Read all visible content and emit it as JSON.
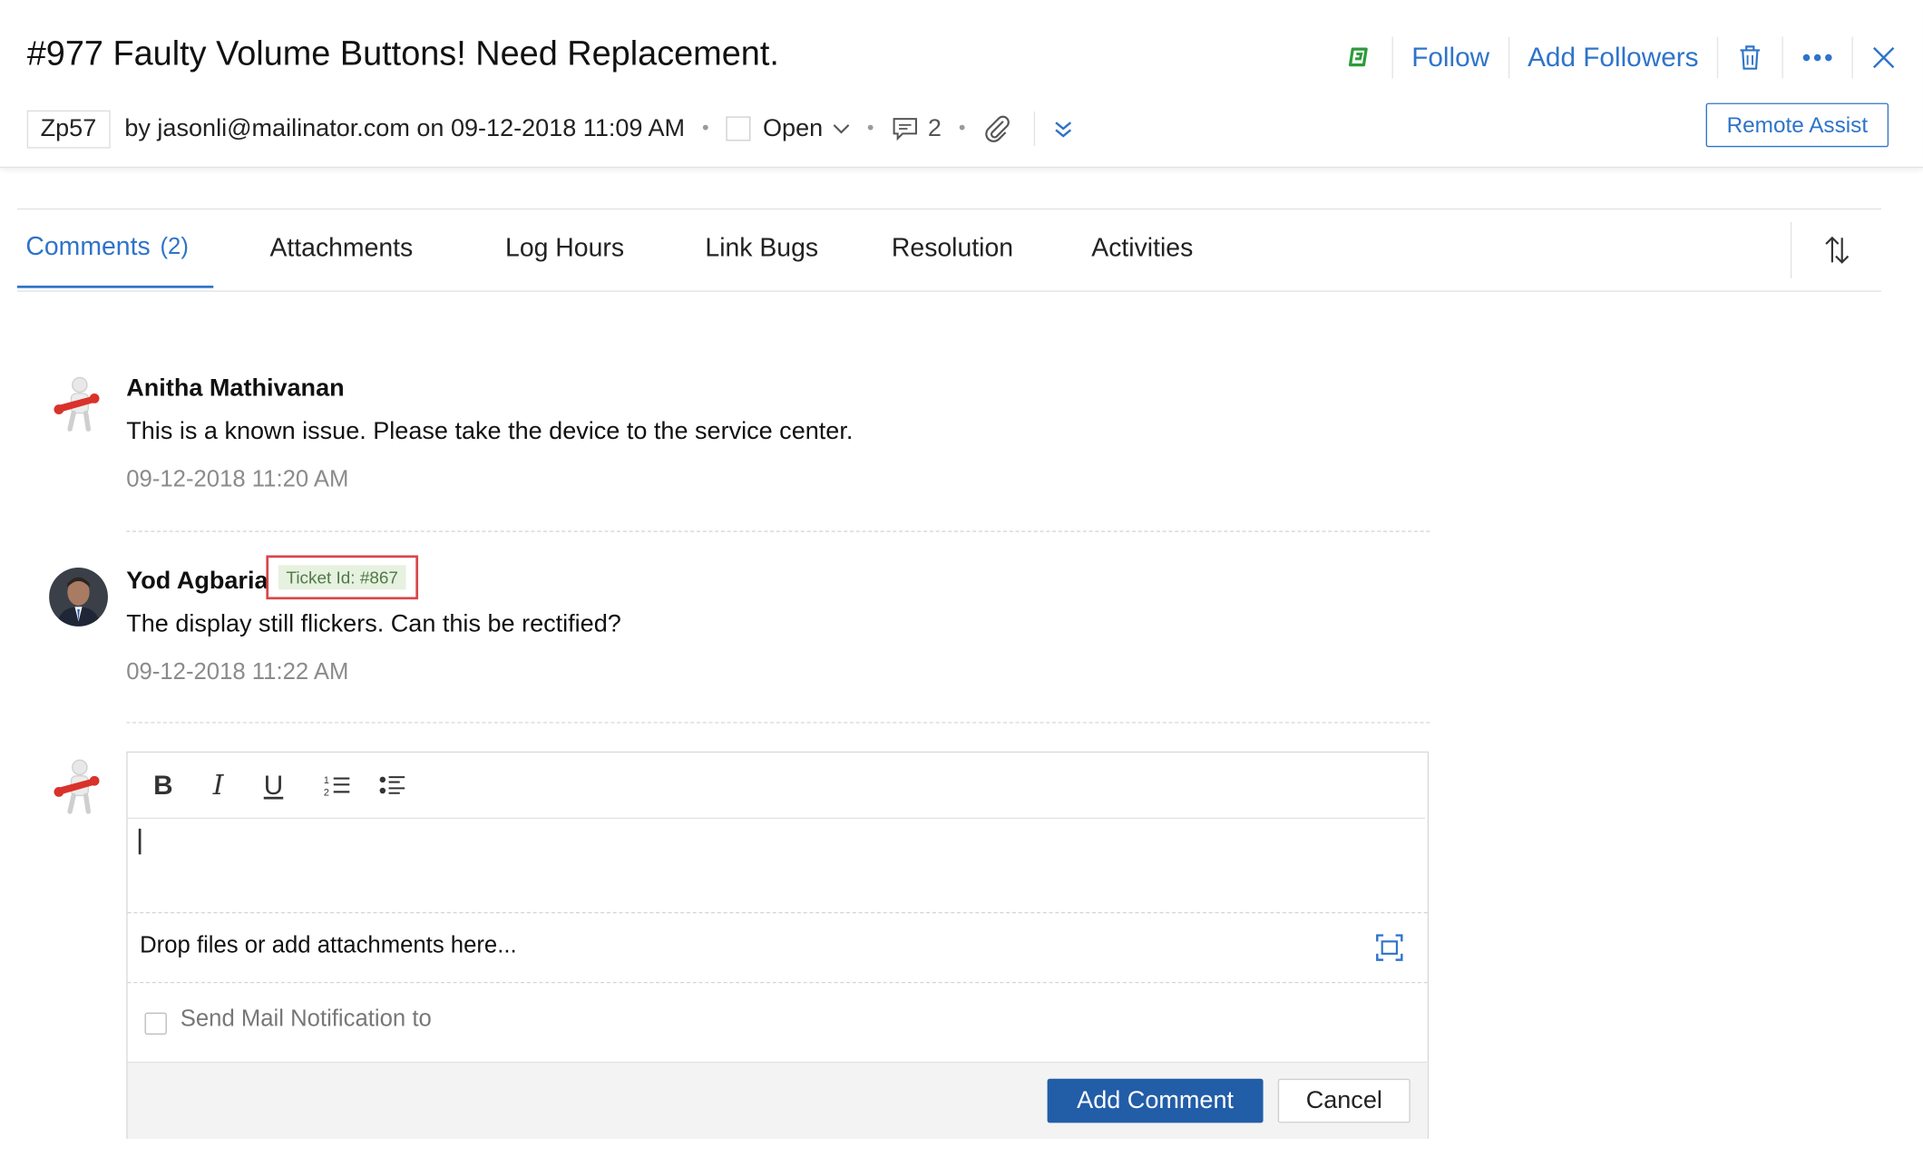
{
  "ticket": {
    "title": "#977 Faulty Volume Buttons! Need Replacement.",
    "tag": "Zp57",
    "byline": "by jasonli@mailinator.com on 09-12-2018 11:09 AM",
    "status": "Open",
    "comment_count": "2"
  },
  "header_actions": {
    "follow": "Follow",
    "add_followers": "Add Followers",
    "remote_assist": "Remote Assist"
  },
  "tabs": [
    {
      "label": "Comments",
      "count": "(2)",
      "active": true
    },
    {
      "label": "Attachments"
    },
    {
      "label": "Log Hours"
    },
    {
      "label": "Link Bugs"
    },
    {
      "label": "Resolution"
    },
    {
      "label": "Activities"
    }
  ],
  "comments": [
    {
      "author": "Anitha Mathivanan",
      "text": "This is a known issue. Please take the device to the service center.",
      "time": "09-12-2018 11:20 AM"
    },
    {
      "author": "Yod Agbaria",
      "badge": "Ticket Id: #867",
      "text": "The display still flickers. Can this be rectified?",
      "time": "09-12-2018 11:22 AM"
    }
  ],
  "editor": {
    "drop_text": "Drop files or add attachments here...",
    "notify_label": "Send Mail Notification to",
    "add_button": "Add Comment",
    "cancel_button": "Cancel"
  },
  "colors": {
    "accent": "#2e74c9",
    "primary_button": "#225da8",
    "highlight_border": "#d9464a",
    "badge_bg": "#e6f1e0",
    "badge_text": "#4f7a44",
    "brand_green": "#2e9a3b"
  },
  "icons": [
    "ticket-brand-icon",
    "trash-icon",
    "more-icon",
    "close-icon",
    "chevron-down-icon",
    "comment-icon",
    "attachment-icon",
    "double-chevron-down-icon",
    "sort-icon",
    "bold-icon",
    "italic-icon",
    "underline-icon",
    "numbered-list-icon",
    "bullet-list-icon",
    "expand-icon",
    "agent-avatar-icon"
  ]
}
